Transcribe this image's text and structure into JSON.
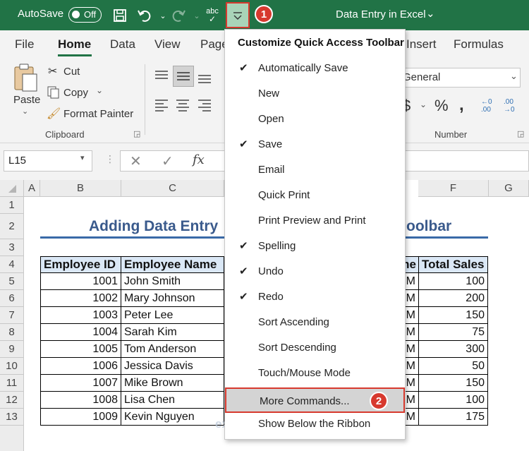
{
  "titlebar": {
    "autosave_label": "AutoSave",
    "autosave_state": "Off",
    "document_title": "Data Entry in Excel",
    "badge_1": "1",
    "badge_2": "2"
  },
  "tabs": [
    {
      "label": "File"
    },
    {
      "label": "Home"
    },
    {
      "label": "Data"
    },
    {
      "label": "View"
    },
    {
      "label": "Page"
    },
    {
      "label": "Insert"
    },
    {
      "label": "Formulas"
    }
  ],
  "ribbon": {
    "paste": "Paste",
    "cut": "Cut",
    "copy": "Copy",
    "format_painter": "Format Painter",
    "clipboard_group": "Clipboard",
    "number_format": "General",
    "number_group": "Number"
  },
  "formula_bar": {
    "name_box": "L15"
  },
  "grid": {
    "columns": [
      "A",
      "B",
      "C",
      "F",
      "G"
    ],
    "rows": [
      "1",
      "2",
      "3",
      "4",
      "5",
      "6",
      "7",
      "8",
      "9",
      "10",
      "11",
      "12",
      "13"
    ],
    "title_left": "Adding Data Entry",
    "title_right": "oolbar",
    "headers": {
      "employee_id": "Employee ID",
      "employee_name": "Employee Name",
      "time_frag": "me",
      "total_sales": "Total Sales"
    },
    "data_rows": [
      {
        "id": "1001",
        "name": "John Smith",
        "frag": "M",
        "sales": "100"
      },
      {
        "id": "1002",
        "name": "Mary Johnson",
        "frag": "M",
        "sales": "200"
      },
      {
        "id": "1003",
        "name": "Peter Lee",
        "frag": "M",
        "sales": "150"
      },
      {
        "id": "1004",
        "name": "Sarah Kim",
        "frag": "M",
        "sales": "75"
      },
      {
        "id": "1005",
        "name": "Tom Anderson",
        "frag": "M",
        "sales": "300"
      },
      {
        "id": "1006",
        "name": "Jessica Davis",
        "frag": "M",
        "sales": "50"
      },
      {
        "id": "1007",
        "name": "Mike Brown",
        "frag": "M",
        "sales": "150"
      },
      {
        "id": "1008",
        "name": "Lisa Chen",
        "frag": "M",
        "sales": "100"
      },
      {
        "id": "1009",
        "name": "Kevin Nguyen",
        "frag": "M",
        "sales": "175"
      }
    ]
  },
  "menu": {
    "heading": "Customize Quick Access Toolbar",
    "items": [
      {
        "label": "Automatically Save",
        "check": "✔"
      },
      {
        "label": "New",
        "check": ""
      },
      {
        "label": "Open",
        "check": ""
      },
      {
        "label": "Save",
        "check": "✔"
      },
      {
        "label": "Email",
        "check": ""
      },
      {
        "label": "Quick Print",
        "check": ""
      },
      {
        "label": "Print Preview and Print",
        "check": ""
      },
      {
        "label": "Spelling",
        "check": "✔"
      },
      {
        "label": "Undo",
        "check": "✔"
      },
      {
        "label": "Redo",
        "check": "✔"
      },
      {
        "label": "Sort Ascending",
        "check": ""
      },
      {
        "label": "Sort Descending",
        "check": ""
      },
      {
        "label": "Touch/Mouse Mode",
        "check": ""
      },
      {
        "label": "More Commands...",
        "check": ""
      },
      {
        "label": "Show Below the Ribbon",
        "check": ""
      }
    ]
  },
  "watermark": "exceldemy",
  "colors": {
    "excel_green": "#217346",
    "highlight_red": "#d7392e",
    "header_fill": "#dbe8f6"
  }
}
